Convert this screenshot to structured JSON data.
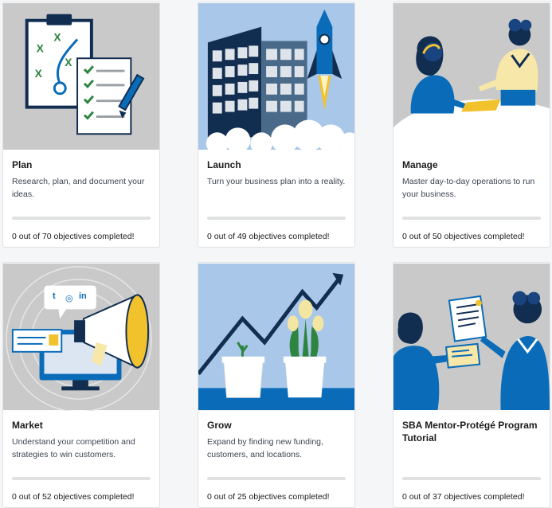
{
  "cards": [
    {
      "title": "Plan",
      "description": "Research, plan, and document your ideas.",
      "completed": 0,
      "total": 70,
      "progress_text": "0 out of 70 objectives completed!",
      "illustration": "clipboard-strategy-icon"
    },
    {
      "title": "Launch",
      "description": "Turn your business plan into a reality.",
      "completed": 0,
      "total": 49,
      "progress_text": "0 out of 49 objectives completed!",
      "illustration": "rocket-launch-icon"
    },
    {
      "title": "Manage",
      "description": "Master day-to-day operations to run your business.",
      "completed": 0,
      "total": 50,
      "progress_text": "0 out of 50 objectives completed!",
      "illustration": "meeting-people-icon"
    },
    {
      "title": "Market",
      "description": "Understand your competition and strategies to win customers.",
      "completed": 0,
      "total": 52,
      "progress_text": "0 out of 52 objectives completed!",
      "illustration": "megaphone-social-icon"
    },
    {
      "title": "Grow",
      "description": "Expand by finding new funding, customers, and locations.",
      "completed": 0,
      "total": 25,
      "progress_text": "0 out of 25 objectives completed!",
      "illustration": "growth-chart-plants-icon"
    },
    {
      "title": "SBA Mentor-Protégé Program Tutorial",
      "description": "",
      "completed": 0,
      "total": 37,
      "progress_text": "0 out of 37 objectives completed!",
      "illustration": "mentor-certificate-icon"
    }
  ],
  "social": {
    "twitter": "t",
    "instagram": "◎",
    "linkedin": "in"
  },
  "colors": {
    "navy": "#112e51",
    "blue": "#0a6cb8",
    "sky": "#a9c7e8",
    "gray": "#c9c9c9",
    "gold": "#f2c22d",
    "white": "#ffffff"
  }
}
